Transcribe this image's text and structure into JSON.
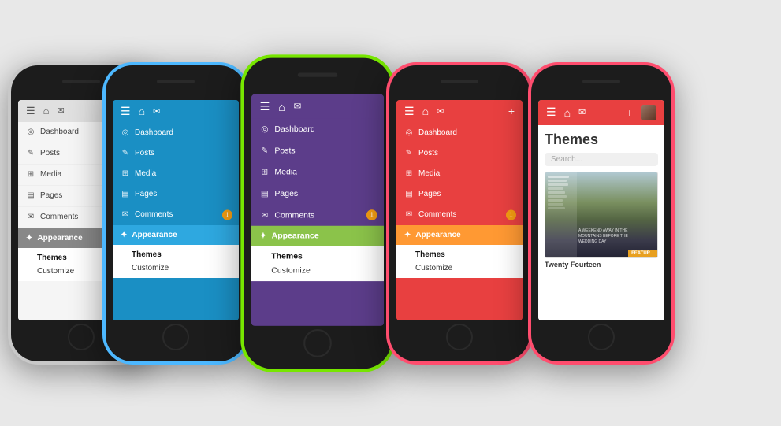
{
  "scene": {
    "background": "#e8e8e8"
  },
  "phones": [
    {
      "id": "phone-1",
      "color": "#d0d0d0",
      "colorName": "white-gray",
      "themeColor": "#888888",
      "screenBg": "#f5f5f5",
      "menuBg": "#f5f5f5",
      "toolbarBg": "#e0e0e0",
      "appearanceBg": "#888888",
      "menuTextColor": "#444444"
    },
    {
      "id": "phone-2",
      "color": "#4db8ff",
      "colorName": "blue",
      "themeColor": "#1a8fc4",
      "screenBg": "#1a8fc4",
      "menuBg": "#1a8fc4",
      "toolbarBg": "#1a8fc4",
      "appearanceBg": "#2ea8e0",
      "menuTextColor": "#ffffff"
    },
    {
      "id": "phone-3",
      "color": "#77e600",
      "colorName": "green",
      "themeColor": "#5c3d8a",
      "screenBg": "#5c3d8a",
      "menuBg": "#5c3d8a",
      "toolbarBg": "#5c3d8a",
      "appearanceBg": "#8bc34a",
      "menuTextColor": "#ffffff"
    },
    {
      "id": "phone-4",
      "color": "#ff4d6e",
      "colorName": "pink",
      "themeColor": "#e84040",
      "screenBg": "#e84040",
      "menuBg": "#e84040",
      "toolbarBg": "#e84040",
      "appearanceBg": "#ff9933",
      "menuTextColor": "#ffffff"
    },
    {
      "id": "phone-5",
      "color": "#ff4d6e",
      "colorName": "pink-themes",
      "themeColor": "#e84040",
      "screenBg": "#ffffff",
      "menuBg": "#ffffff",
      "toolbarBg": "#e84040",
      "appearanceBg": "#ff9933",
      "menuTextColor": "#333333"
    }
  ],
  "menuItems": [
    {
      "label": "Dashboard",
      "icon": "◎"
    },
    {
      "label": "Posts",
      "icon": "✎"
    },
    {
      "label": "Media",
      "icon": "⊞"
    },
    {
      "label": "Pages",
      "icon": "▤"
    },
    {
      "label": "Comments",
      "icon": "✉",
      "badge": "1"
    }
  ],
  "appearance": {
    "label": "Appearance",
    "icon": "✦"
  },
  "subMenu": {
    "themes": "Themes",
    "customize": "Customize"
  },
  "themesScreen": {
    "title": "Themes",
    "searchPlaceholder": "Search...",
    "themeName": "Twenty Fourteen"
  },
  "toolbar": {
    "icons": [
      "☰",
      "⌂",
      "✉",
      "+"
    ]
  }
}
